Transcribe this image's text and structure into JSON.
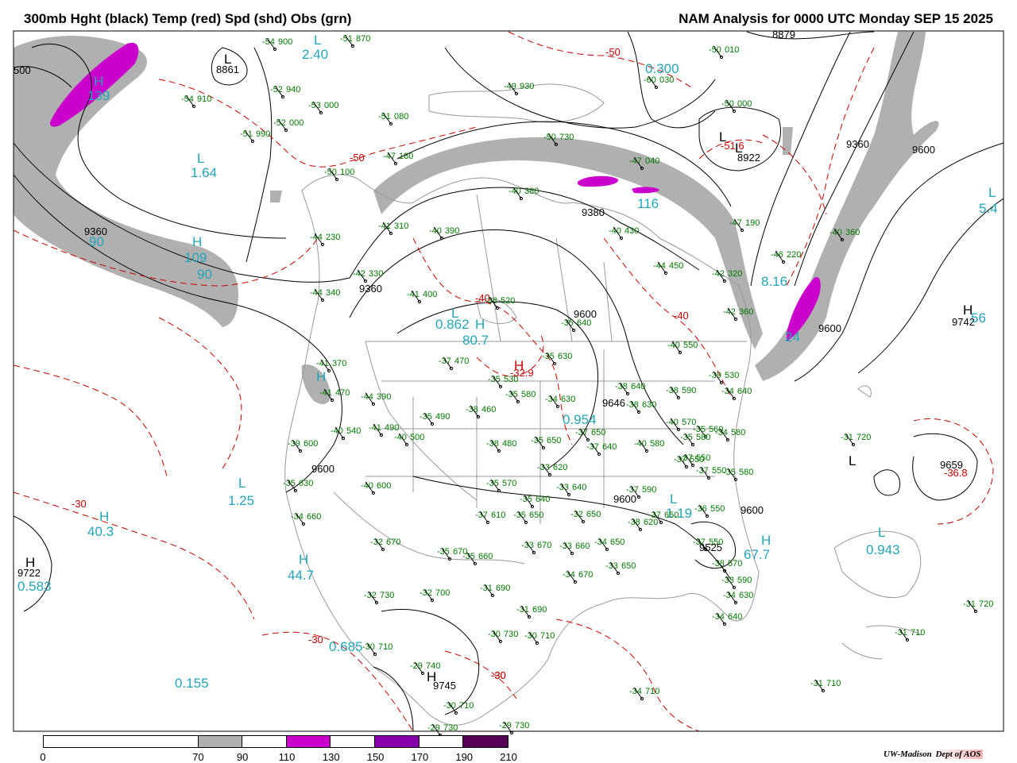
{
  "header": {
    "title_left": "300mb Hght (black) Temp (red) Spd (shd) Obs (grn)",
    "title_right": "NAM Analysis for 0000 UTC Monday  SEP 15 2025"
  },
  "colors": {
    "height": "#000000",
    "temp": "#cc0000",
    "speed_70_90": "#b0b0b0",
    "speed_110_130": "#cc00cc",
    "speed_150_170": "#8800aa",
    "speed_190_210": "#550055",
    "obs": "#007700",
    "anom": "#22a5b8",
    "border": "#999999"
  },
  "legend": {
    "ticks": [
      "0",
      "70",
      "90",
      "110",
      "130",
      "150",
      "170",
      "190",
      "210"
    ],
    "bins": [
      {
        "from": 0,
        "to": 70,
        "color": "#ffffff"
      },
      {
        "from": 70,
        "to": 90,
        "color": "#b0b0b0"
      },
      {
        "from": 90,
        "to": 110,
        "color": "#ffffff"
      },
      {
        "from": 110,
        "to": 130,
        "color": "#cc00cc"
      },
      {
        "from": 130,
        "to": 150,
        "color": "#ffffff"
      },
      {
        "from": 150,
        "to": 170,
        "color": "#8800aa"
      },
      {
        "from": 170,
        "to": 190,
        "color": "#ffffff"
      },
      {
        "from": 190,
        "to": 210,
        "color": "#550055"
      }
    ]
  },
  "credit": {
    "org": "UW-Madison",
    "dept": "Dept of AOS"
  },
  "height_labels": [
    "8879",
    "8861",
    "8922",
    "9360",
    "9360",
    "9360",
    "9380",
    "9600",
    "9600",
    "9600",
    "9600",
    "9600",
    "9600",
    "9722",
    "9742",
    "9745",
    "9659",
    "9525",
    "9646",
    "500"
  ],
  "temp_labels": [
    "-50",
    "-50",
    "-40",
    "-40",
    "-30",
    "-30",
    "-30",
    "-32.9",
    "-51.6",
    "-36.8",
    "-30"
  ],
  "centers_LH": [
    "L",
    "L",
    "L",
    "L",
    "L",
    "L",
    "L",
    "L",
    "L",
    "L",
    "L",
    "H",
    "H",
    "H",
    "H",
    "H",
    "H",
    "H",
    "H",
    "H",
    "H",
    "H"
  ],
  "anom_values": [
    "2.40",
    "1.64",
    "0.300",
    "0.862",
    "0.954",
    "8.16",
    "5.4",
    "1.25",
    "40.3",
    "44.7",
    "0.583",
    "0.685",
    "0.155",
    "1.19",
    "67.7",
    "0.943",
    "80.7",
    "109",
    "90",
    "90",
    "116",
    "139",
    "24",
    "56"
  ],
  "stations": [
    {
      "t": "-54",
      "h": "900"
    },
    {
      "t": "-51",
      "h": "870"
    },
    {
      "t": "-54",
      "h": "910"
    },
    {
      "t": "-52",
      "h": "940"
    },
    {
      "t": "-53",
      "h": "000"
    },
    {
      "t": "-52",
      "h": "000"
    },
    {
      "t": "-51",
      "h": "990"
    },
    {
      "t": "-51",
      "h": "080"
    },
    {
      "t": "-49",
      "h": "930"
    },
    {
      "t": "-50",
      "h": "010"
    },
    {
      "t": "-60",
      "h": "030"
    },
    {
      "t": "-50",
      "h": "730"
    },
    {
      "t": "-50",
      "h": "000"
    },
    {
      "t": "-47",
      "h": "180"
    },
    {
      "t": "-50",
      "h": "100"
    },
    {
      "t": "-47",
      "h": "040"
    },
    {
      "t": "-47",
      "h": "190"
    },
    {
      "t": "-40",
      "h": "360"
    },
    {
      "t": "-46",
      "h": "220"
    },
    {
      "t": "-40",
      "h": "390"
    },
    {
      "t": "-41",
      "h": "310"
    },
    {
      "t": "-40",
      "h": "380"
    },
    {
      "t": "-40",
      "h": "430"
    },
    {
      "t": "-44",
      "h": "450"
    },
    {
      "t": "-42",
      "h": "320"
    },
    {
      "t": "-44",
      "h": "230"
    },
    {
      "t": "-42",
      "h": "330"
    },
    {
      "t": "-44",
      "h": "340"
    },
    {
      "t": "-41",
      "h": "400"
    },
    {
      "t": "-38",
      "h": "520"
    },
    {
      "t": "-35",
      "h": "640"
    },
    {
      "t": "-42",
      "h": "360"
    },
    {
      "t": "-40",
      "h": "550"
    },
    {
      "t": "-35",
      "h": "630"
    },
    {
      "t": "-37",
      "h": "470"
    },
    {
      "t": "-35",
      "h": "530"
    },
    {
      "t": "-39",
      "h": "530"
    },
    {
      "t": "-34",
      "h": "640"
    },
    {
      "t": "-41",
      "h": "370"
    },
    {
      "t": "-41",
      "h": "470"
    },
    {
      "t": "-44",
      "h": "390"
    },
    {
      "t": "-35",
      "h": "580"
    },
    {
      "t": "-34",
      "h": "630"
    },
    {
      "t": "-37",
      "h": "650"
    },
    {
      "t": "-38",
      "h": "640"
    },
    {
      "t": "-38",
      "h": "590"
    },
    {
      "t": "-38",
      "h": "460"
    },
    {
      "t": "-35",
      "h": "490"
    },
    {
      "t": "-38",
      "h": "630"
    },
    {
      "t": "-40",
      "h": "570"
    },
    {
      "t": "-35",
      "h": "560"
    },
    {
      "t": "-34",
      "h": "580"
    },
    {
      "t": "-40",
      "h": "540"
    },
    {
      "t": "-41",
      "h": "490"
    },
    {
      "t": "-40",
      "h": "500"
    },
    {
      "t": "-35",
      "h": "650"
    },
    {
      "t": "-39",
      "h": "600"
    },
    {
      "t": "-38",
      "h": "480"
    },
    {
      "t": "-35",
      "h": "580"
    },
    {
      "t": "-37",
      "h": "640"
    },
    {
      "t": "-40",
      "h": "580"
    },
    {
      "t": "-37",
      "h": "550"
    },
    {
      "t": "-37",
      "h": "550"
    },
    {
      "t": "-35",
      "h": "580"
    },
    {
      "t": "-37",
      "h": "550"
    },
    {
      "t": "-35",
      "h": "630"
    },
    {
      "t": "-40",
      "h": "600"
    },
    {
      "t": "-35",
      "h": "570"
    },
    {
      "t": "-33",
      "h": "620"
    },
    {
      "t": "-37",
      "h": "590"
    },
    {
      "t": "-35",
      "h": "640"
    },
    {
      "t": "-33",
      "h": "640"
    },
    {
      "t": "-32",
      "h": "650"
    },
    {
      "t": "-38",
      "h": "620"
    },
    {
      "t": "-37",
      "h": "650"
    },
    {
      "t": "-37",
      "h": "610"
    },
    {
      "t": "-35",
      "h": "650"
    },
    {
      "t": "-36",
      "h": "550"
    },
    {
      "t": "-34",
      "h": "660"
    },
    {
      "t": "-32",
      "h": "670"
    },
    {
      "t": "-33",
      "h": "660"
    },
    {
      "t": "-34",
      "h": "650"
    },
    {
      "t": "-37",
      "h": "550"
    },
    {
      "t": "-33",
      "h": "670"
    },
    {
      "t": "-33",
      "h": "650"
    },
    {
      "t": "-34",
      "h": "670"
    },
    {
      "t": "-35",
      "h": "670"
    },
    {
      "t": "-35",
      "h": "660"
    },
    {
      "t": "-38",
      "h": "570"
    },
    {
      "t": "-33",
      "h": "590"
    },
    {
      "t": "-32",
      "h": "730"
    },
    {
      "t": "-32",
      "h": "700"
    },
    {
      "t": "-31",
      "h": "690"
    },
    {
      "t": "-31",
      "h": "690"
    },
    {
      "t": "-34",
      "h": "630"
    },
    {
      "t": "-30",
      "h": "730"
    },
    {
      "t": "-30",
      "h": "710"
    },
    {
      "t": "-30",
      "h": "710"
    },
    {
      "t": "-34",
      "h": "640"
    },
    {
      "t": "-29",
      "h": "740"
    },
    {
      "t": "-30",
      "h": "710"
    },
    {
      "t": "-29",
      "h": "730"
    },
    {
      "t": "-29",
      "h": "730"
    },
    {
      "t": "-34",
      "h": "710"
    },
    {
      "t": "-31",
      "h": "710"
    },
    {
      "t": "-31",
      "h": "710"
    },
    {
      "t": "-31",
      "h": "720"
    },
    {
      "t": "-31",
      "h": "720"
    }
  ]
}
